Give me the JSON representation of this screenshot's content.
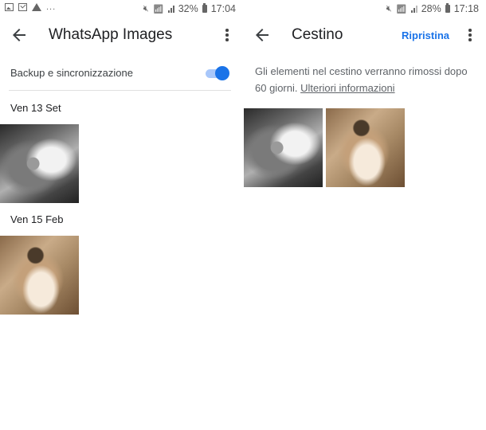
{
  "left_screen": {
    "status_bar": {
      "notification_icons": [
        "gallery-icon",
        "checkbox-icon",
        "warning-icon",
        "more-notifications-icon"
      ],
      "more_text": "...",
      "battery_percent": "32%",
      "time": "17:04"
    },
    "app_bar": {
      "back_icon": "arrow-back-icon",
      "title": "WhatsApp Images",
      "menu_icon": "more-vert-icon"
    },
    "backup_setting": {
      "label": "Backup e sincronizzazione",
      "enabled": true
    },
    "groups": [
      {
        "date": "Ven 13 Set",
        "photos": [
          {
            "tone": "grayscale",
            "subject": "cat"
          }
        ]
      },
      {
        "date": "Ven 15 Feb",
        "photos": [
          {
            "tone": "sepia",
            "subject": "cat"
          }
        ]
      }
    ]
  },
  "right_screen": {
    "status_bar": {
      "battery_percent": "28%",
      "time": "17:18"
    },
    "app_bar": {
      "back_icon": "arrow-back-icon",
      "title": "Cestino",
      "restore_label": "Ripristina",
      "menu_icon": "more-vert-icon"
    },
    "info": {
      "message": "Gli elementi nel cestino verranno rimossi dopo 60 giorni. ",
      "link_label": "Ulteriori informazioni"
    },
    "photos": [
      {
        "tone": "grayscale",
        "subject": "cat"
      },
      {
        "tone": "sepia",
        "subject": "cat"
      }
    ]
  },
  "colors": {
    "accent": "#1a73e8",
    "toggle_track": "#a8c7fa",
    "text_primary": "#202124",
    "text_secondary": "#5f6368",
    "divider": "#e0e0e0"
  }
}
